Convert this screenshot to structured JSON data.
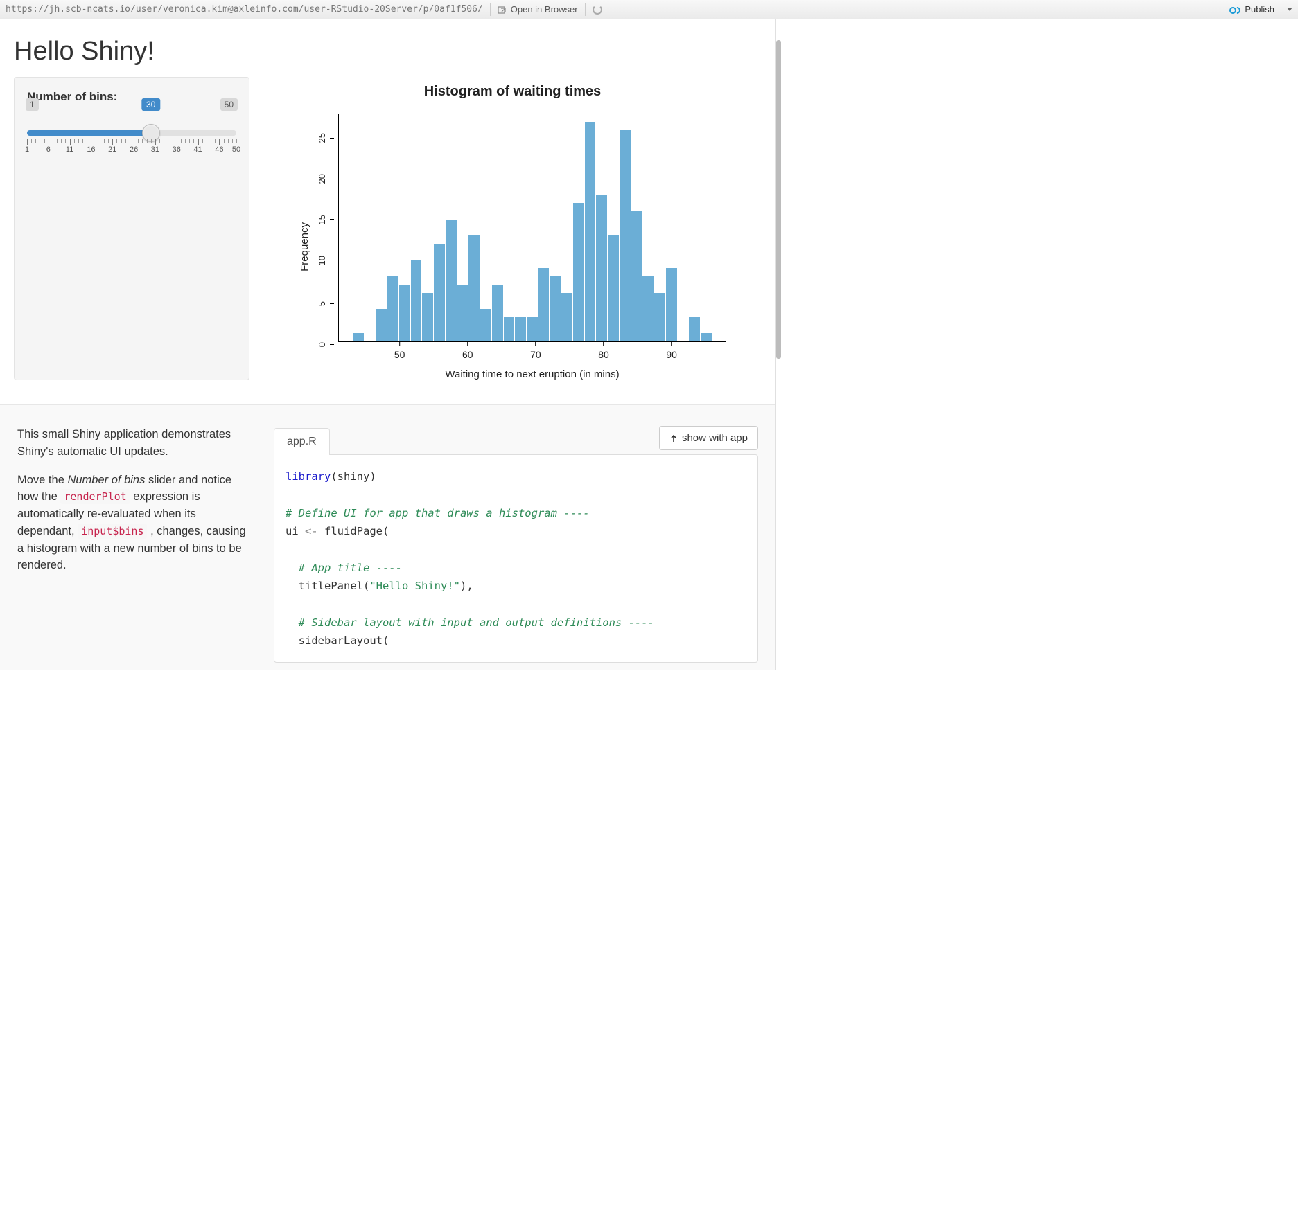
{
  "topbar": {
    "url": "https://jh.scb-ncats.io/user/veronica.kim@axleinfo.com/user-RStudio-20Server/p/0af1f506/",
    "open_label": "Open in Browser",
    "publish_label": "Publish"
  },
  "app": {
    "title": "Hello Shiny!",
    "slider": {
      "label": "Number of bins:",
      "min": 1,
      "max": 50,
      "value": 30,
      "ticks": [
        1,
        6,
        11,
        16,
        21,
        26,
        31,
        36,
        41,
        46,
        50
      ]
    }
  },
  "chart_data": {
    "type": "bar",
    "title": "Histogram of waiting times",
    "xlabel": "Waiting time to next eruption (in mins)",
    "ylabel": "Frequency",
    "ylim": [
      0,
      28
    ],
    "yticks": [
      0,
      5,
      10,
      15,
      20,
      25
    ],
    "xticks": [
      50,
      60,
      70,
      80,
      90
    ],
    "x_range": [
      43,
      96
    ],
    "bin_edges": [
      43.0,
      44.77,
      46.53,
      48.3,
      50.07,
      51.83,
      53.6,
      55.37,
      57.13,
      58.9,
      60.67,
      62.43,
      64.2,
      65.97,
      67.73,
      69.5,
      71.27,
      73.03,
      74.8,
      76.57,
      78.33,
      80.1,
      81.87,
      83.63,
      85.4,
      87.17,
      88.93,
      90.7,
      92.47,
      94.23,
      96.0
    ],
    "values": [
      1,
      0,
      4,
      8,
      7,
      10,
      6,
      12,
      15,
      7,
      13,
      4,
      7,
      3,
      3,
      3,
      9,
      8,
      6,
      17,
      27,
      18,
      13,
      26,
      16,
      8,
      6,
      9,
      0,
      3,
      1
    ]
  },
  "lower": {
    "desc_p1": "This small Shiny application demonstrates Shiny's automatic UI updates.",
    "desc_p2a": "Move the ",
    "desc_p2_em": "Number of bins",
    "desc_p2b": " slider and notice how the ",
    "desc_p2_code1": "renderPlot",
    "desc_p2c": " expression is automatically re-evaluated when its dependant, ",
    "desc_p2_code2": "input$bins",
    "desc_p2d": " , changes, causing a histogram with a new number of bins to be rendered.",
    "tab_label": "app.R",
    "show_label": "show with app",
    "code": {
      "l1a": "library",
      "l1b": "(shiny)",
      "l2": "# Define UI for app that draws a histogram ----",
      "l3a": "ui ",
      "l3b": "<-",
      "l3c": " fluidPage(",
      "l4": "  # App title ----",
      "l5a": "  titlePanel(",
      "l5b": "\"Hello Shiny!\"",
      "l5c": "),",
      "l6": "  # Sidebar layout with input and output definitions ----",
      "l7": "  sidebarLayout("
    }
  }
}
